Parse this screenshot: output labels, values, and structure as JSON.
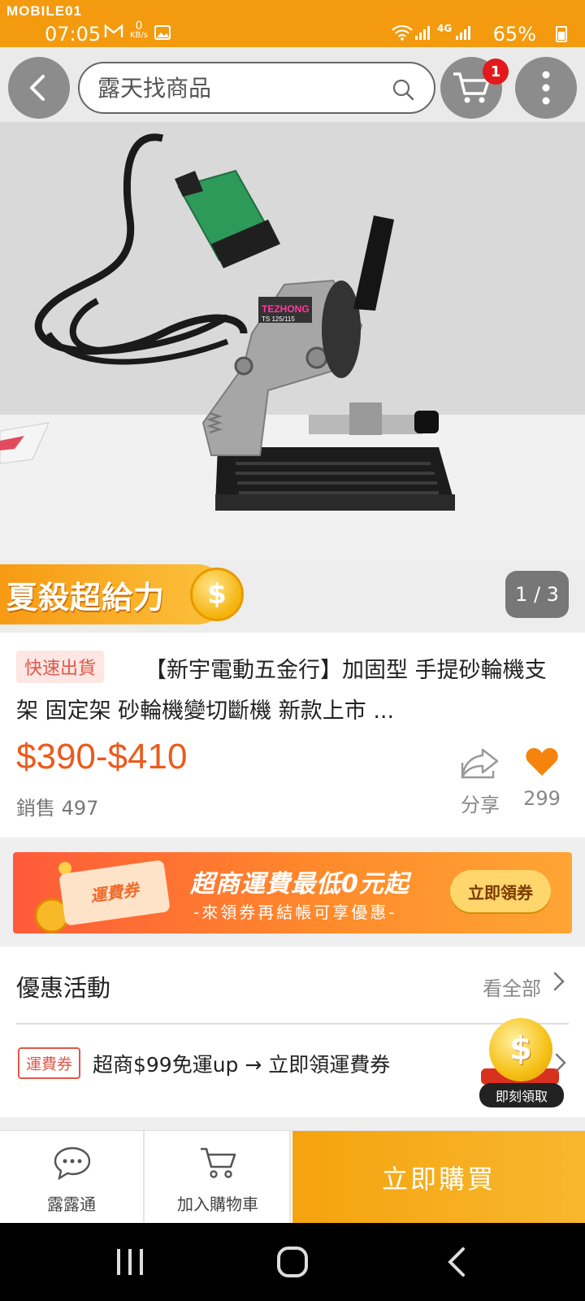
{
  "status_bar": {
    "brand": "MOBILE01",
    "time": "07:05",
    "net_speed_value": "0",
    "net_speed_unit": "KB/s",
    "network_type": "4G",
    "battery": "65%"
  },
  "header": {
    "search_placeholder": "露天找商品",
    "cart_count": "1"
  },
  "gallery": {
    "page_indicator": "1 / 3",
    "image_brand_text": "TEZHONG",
    "image_model_text": "TS 125/115"
  },
  "promo": {
    "ribbon_text": "夏殺超給力",
    "coin_symbol": "$"
  },
  "product": {
    "badge": "快速出貨",
    "title": "【新宇電動五金行】加固型 手提砂輪機支架 固定架 砂輪機變切斷機 新款上市 ...",
    "price": "$390-$410",
    "sales": "銷售 497",
    "share_label": "分享",
    "favorites_count": "299"
  },
  "coupon_banner": {
    "ticket_text": "運費券",
    "title": "超商運費最低0元起",
    "subtitle": "-來領券再結帳可享優惠-",
    "button": "立即領券"
  },
  "offers": {
    "title": "優惠活動",
    "see_all": "看全部",
    "item_tag": "運費券",
    "item_text": "超商$99免運up → 立即領運費券",
    "float_label": "即刻領取",
    "float_coin_symbol": "$"
  },
  "action_bar": {
    "chat_label": "露露通",
    "add_cart_label": "加入購物車",
    "buy_label": "立即購買"
  },
  "colors": {
    "accent": "#f39a0e",
    "price": "#ea5b1c",
    "badge_red": "#e3191c"
  }
}
